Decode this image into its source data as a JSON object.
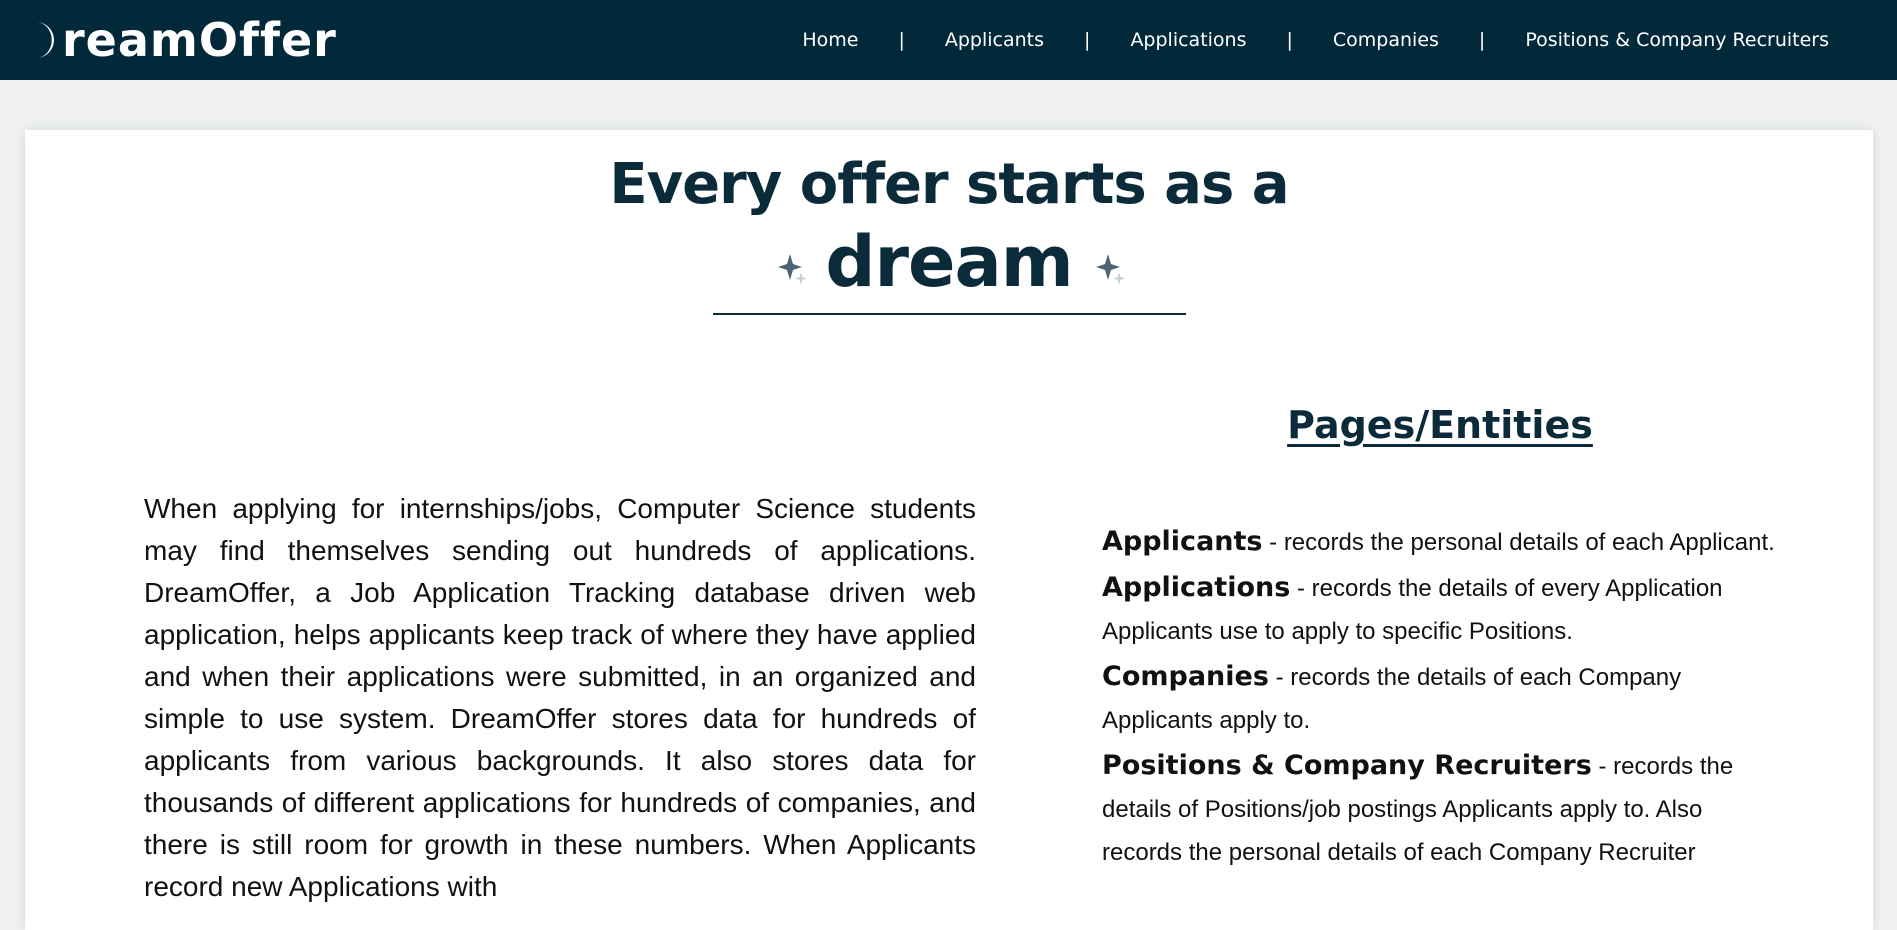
{
  "header": {
    "logo_text": "reamOffer",
    "nav": [
      "Home",
      "Applicants",
      "Applications",
      "Companies",
      "Positions & Company Recruiters"
    ],
    "separator": "|"
  },
  "hero": {
    "line1": "Every offer starts as a",
    "line2": "dream"
  },
  "intro": {
    "text": "When applying for internships/jobs, Computer Science students may find themselves sending out hundreds of applications. DreamOffer, a Job Application Tracking database driven web application, helps applicants keep track of where they have applied and when their applications were submitted, in an organized and simple to use system. DreamOffer stores data for hundreds of applicants from various backgrounds. It also stores data for thousands of different applications for hundreds of companies, and there is still room for growth in these numbers. When Applicants record new Applications with"
  },
  "entities": {
    "title": "Pages/Entities",
    "items": [
      {
        "name": "Applicants",
        "desc": " - records the personal details of each Applicant."
      },
      {
        "name": "Applications",
        "desc": " - records the details of every Application Applicants use to apply to specific Positions."
      },
      {
        "name": "Companies",
        "desc": " - records the details of each Company Applicants apply to."
      },
      {
        "name": "Positions & Company Recruiters",
        "desc": " - records the details of Positions/job postings Applicants apply to. Also records the personal details of each Company Recruiter"
      }
    ]
  },
  "colors": {
    "header_bg": "#02293a",
    "page_bg": "#eef1ee",
    "title_color": "#0b2b3a",
    "card_bg": "#ffffff"
  },
  "icons": {
    "logo": "crescent-moon-icon",
    "sparkle": "sparkle-icon"
  }
}
